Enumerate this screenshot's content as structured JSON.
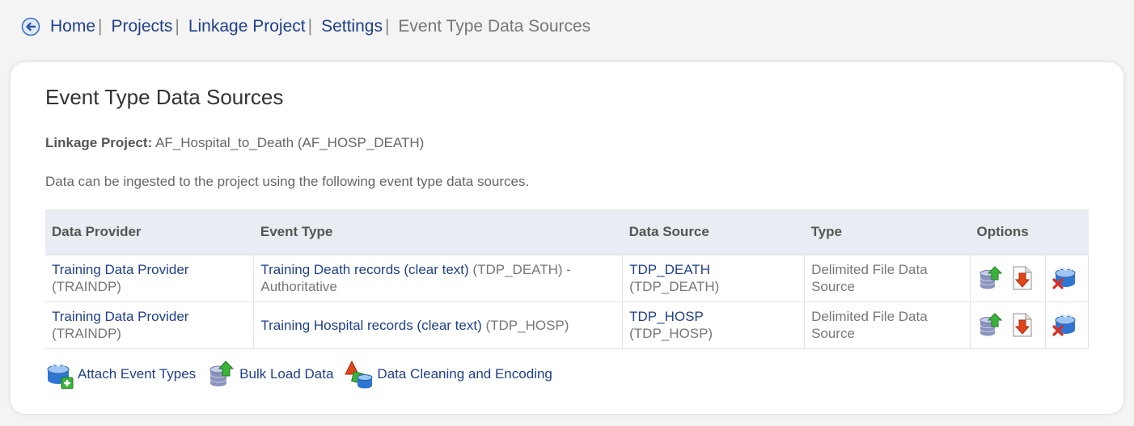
{
  "breadcrumb": {
    "items": [
      {
        "label": "Home",
        "sep": "|"
      },
      {
        "label": "Projects",
        "sep": "|"
      },
      {
        "label": "Linkage Project",
        "sep": "|"
      },
      {
        "label": "Settings",
        "sep": "|"
      }
    ],
    "current": "Event Type Data Sources"
  },
  "page": {
    "title": "Event Type Data Sources",
    "project_label": "Linkage Project:",
    "project_value": "AF_Hospital_to_Death (AF_HOSP_DEATH)",
    "description": "Data can be ingested to the project using the following event type data sources."
  },
  "table": {
    "headers": [
      "Data Provider",
      "Event Type",
      "Data Source",
      "Type",
      "Options"
    ],
    "rows": [
      {
        "provider_name": "Training Data Provider",
        "provider_code": "(TRAINDP)",
        "event_name": "Training Death records (clear text)",
        "event_code": "(TDP_DEATH) -",
        "event_note": "Authoritative",
        "source_name": "TDP_DEATH",
        "source_code": "(TDP_DEATH)",
        "type_line1": "Delimited File Data",
        "type_line2": "Source"
      },
      {
        "provider_name": "Training Data Provider",
        "provider_code": "(TRAINDP)",
        "event_name": "Training Hospital records (clear text)",
        "event_code": "(TDP_HOSP)",
        "event_note": "",
        "source_name": "TDP_HOSP",
        "source_code": "(TDP_HOSP)",
        "type_line1": "Delimited File Data",
        "type_line2": "Source"
      }
    ]
  },
  "actions": {
    "attach": "Attach Event Types",
    "bulk_load": "Bulk Load Data",
    "cleaning": "Data Cleaning and Encoding"
  },
  "colors": {
    "link": "#1f3f8a",
    "header_bg": "#e8edf3",
    "db_blue": "#3a7fd0",
    "upload_green": "#3bb33b",
    "download_red": "#e0451c"
  }
}
